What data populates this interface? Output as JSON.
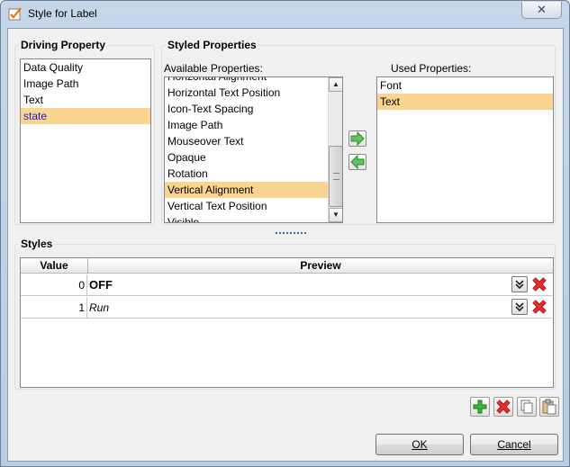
{
  "window": {
    "title": "Style for Label",
    "close_glyph": "✕"
  },
  "driving_property": {
    "title": "Driving Property",
    "items": [
      {
        "label": "Data Quality",
        "selected": false
      },
      {
        "label": "Image Path",
        "selected": false
      },
      {
        "label": "Text",
        "selected": false
      },
      {
        "label": "state",
        "selected": true
      }
    ]
  },
  "styled_properties": {
    "title": "Styled Properties",
    "available_label": "Available Properties:",
    "used_label": "Used Properties:",
    "available_items": [
      "Horizontal Alignment",
      "Horizontal Text Position",
      "Icon-Text Spacing",
      "Image Path",
      "Mouseover Text",
      "Opaque",
      "Rotation",
      "Vertical Alignment",
      "Vertical Text Position",
      "Visible"
    ],
    "available_selected": "Vertical Alignment",
    "used_items": [
      "Font",
      "Text"
    ],
    "used_selected": "Text"
  },
  "styles": {
    "title": "Styles",
    "columns": {
      "value": "Value",
      "preview": "Preview"
    },
    "rows": [
      {
        "value": "0",
        "preview": "OFF"
      },
      {
        "value": "1",
        "preview": "Run"
      }
    ]
  },
  "buttons": {
    "ok": "OK",
    "cancel": "Cancel"
  },
  "colors": {
    "selection": "#fad591",
    "driving_selected_text": "#1a1ad0",
    "delete_red": "#d42020",
    "add_green": "#2ea02e"
  }
}
